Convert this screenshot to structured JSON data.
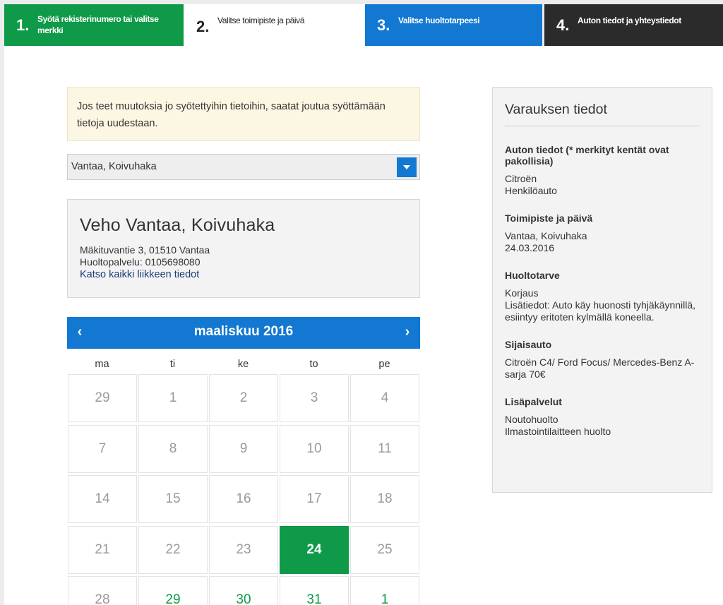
{
  "steps": [
    {
      "num": "1.",
      "label": "Syötä rekisterinumero tai valitse merkki"
    },
    {
      "num": "2.",
      "label": "Valitse toimipiste ja päivä"
    },
    {
      "num": "3.",
      "label": "Valitse huoltotarpeesi"
    },
    {
      "num": "4.",
      "label": "Auton tiedot ja yhteystiedot"
    }
  ],
  "warning": "Jos teet muutoksia jo syötettyihin tietoihin, saatat joutua syöttämään tietoja uudestaan.",
  "location_select": {
    "value": "Vantaa, Koivuhaka"
  },
  "location": {
    "name": "Veho Vantaa, Koivuhaka",
    "address": "Mäkituvantie 3, 01510 Vantaa",
    "service_phone": "Huoltopalvelu: 0105698080",
    "details_link": "Katso kaikki liikkeen tiedot"
  },
  "calendar": {
    "month": "maaliskuu 2016",
    "prev": "‹",
    "next": "›",
    "weekdays": [
      "ma",
      "ti",
      "ke",
      "to",
      "pe"
    ],
    "days": [
      {
        "d": "29",
        "state": "past"
      },
      {
        "d": "1",
        "state": "past"
      },
      {
        "d": "2",
        "state": "past"
      },
      {
        "d": "3",
        "state": "past"
      },
      {
        "d": "4",
        "state": "past"
      },
      {
        "d": "7",
        "state": "past"
      },
      {
        "d": "8",
        "state": "past"
      },
      {
        "d": "9",
        "state": "past"
      },
      {
        "d": "10",
        "state": "past"
      },
      {
        "d": "11",
        "state": "past"
      },
      {
        "d": "14",
        "state": "past"
      },
      {
        "d": "15",
        "state": "past"
      },
      {
        "d": "16",
        "state": "past"
      },
      {
        "d": "17",
        "state": "past"
      },
      {
        "d": "18",
        "state": "past"
      },
      {
        "d": "21",
        "state": "past"
      },
      {
        "d": "22",
        "state": "past"
      },
      {
        "d": "23",
        "state": "past"
      },
      {
        "d": "24",
        "state": "selected"
      },
      {
        "d": "25",
        "state": "past"
      },
      {
        "d": "28",
        "state": "past"
      },
      {
        "d": "29",
        "state": "available"
      },
      {
        "d": "30",
        "state": "available"
      },
      {
        "d": "31",
        "state": "available"
      },
      {
        "d": "1",
        "state": "available"
      }
    ]
  },
  "summary": {
    "title": "Varauksen tiedot",
    "sections": [
      {
        "heading": "Auton tiedot (* merkityt kentät ovat pakollisia)",
        "lines": [
          "Citroën",
          "Henkilöauto"
        ]
      },
      {
        "heading": "Toimipiste ja päivä",
        "lines": [
          "Vantaa, Koivuhaka",
          "24.03.2016"
        ]
      },
      {
        "heading": "Huoltotarve",
        "lines": [
          "Korjaus",
          "Lisätiedot: Auto käy huonosti tyhjäkäynnillä, esiintyy eritoten kylmällä koneella."
        ]
      },
      {
        "heading": "Sijaisauto",
        "lines": [
          "Citroën C4/ Ford Focus/ Mercedes-Benz A-sarja 70€"
        ]
      },
      {
        "heading": "Lisäpalvelut",
        "lines": [
          "Noutohuolto",
          "Ilmastointilaitteen huolto"
        ]
      }
    ]
  }
}
